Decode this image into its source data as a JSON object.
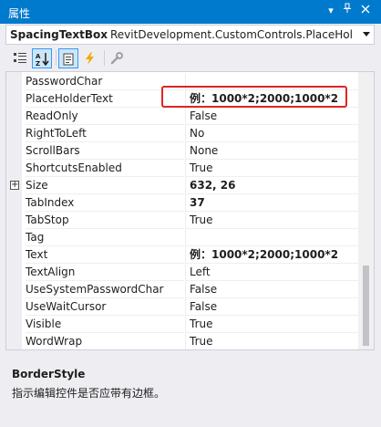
{
  "window": {
    "title": "属性",
    "dropdown_glyph": "▾",
    "pin_glyph": "†",
    "close_glyph": "×"
  },
  "selector": {
    "object_name": "SpacingTextBox",
    "object_type": "RevitDevelopment.CustomControls.PlaceHolderTextBox"
  },
  "toolbar": {
    "buttons": [
      {
        "name": "categorized-view",
        "icon": "categorized-icon",
        "active": false
      },
      {
        "name": "alphabetical-view",
        "icon": "alphabetical-icon",
        "active": true
      },
      {
        "name": "properties-view",
        "icon": "properties-icon",
        "active": true
      },
      {
        "name": "events-view",
        "icon": "lightning-icon",
        "active": false
      },
      {
        "name": "property-pages",
        "icon": "wrench-icon",
        "active": false
      }
    ]
  },
  "properties": [
    {
      "name": "PasswordChar",
      "value": "",
      "bold": false,
      "expandable": false
    },
    {
      "name": "PlaceHolderText",
      "value": "例：1000*2;2000;1000*2",
      "bold": true,
      "expandable": false
    },
    {
      "name": "ReadOnly",
      "value": "False",
      "bold": false,
      "expandable": false
    },
    {
      "name": "RightToLeft",
      "value": "No",
      "bold": false,
      "expandable": false
    },
    {
      "name": "ScrollBars",
      "value": "None",
      "bold": false,
      "expandable": false
    },
    {
      "name": "ShortcutsEnabled",
      "value": "True",
      "bold": false,
      "expandable": false
    },
    {
      "name": "Size",
      "value": "632, 26",
      "bold": true,
      "expandable": true
    },
    {
      "name": "TabIndex",
      "value": "37",
      "bold": true,
      "expandable": false
    },
    {
      "name": "TabStop",
      "value": "True",
      "bold": false,
      "expandable": false
    },
    {
      "name": "Tag",
      "value": "",
      "bold": false,
      "expandable": false
    },
    {
      "name": "Text",
      "value": "例：1000*2;2000;1000*2",
      "bold": true,
      "expandable": false
    },
    {
      "name": "TextAlign",
      "value": "Left",
      "bold": false,
      "expandable": false
    },
    {
      "name": "UseSystemPasswordChar",
      "value": "False",
      "bold": false,
      "expandable": false
    },
    {
      "name": "UseWaitCursor",
      "value": "False",
      "bold": false,
      "expandable": false
    },
    {
      "name": "Visible",
      "value": "True",
      "bold": false,
      "expandable": false
    },
    {
      "name": "WordWrap",
      "value": "True",
      "bold": false,
      "expandable": false
    }
  ],
  "description": {
    "property": "BorderStyle",
    "text": "指示编辑控件是否应带有边框。"
  },
  "colors": {
    "accent": "#007acc",
    "highlight": "#e02424",
    "background": "#eeeef2"
  }
}
